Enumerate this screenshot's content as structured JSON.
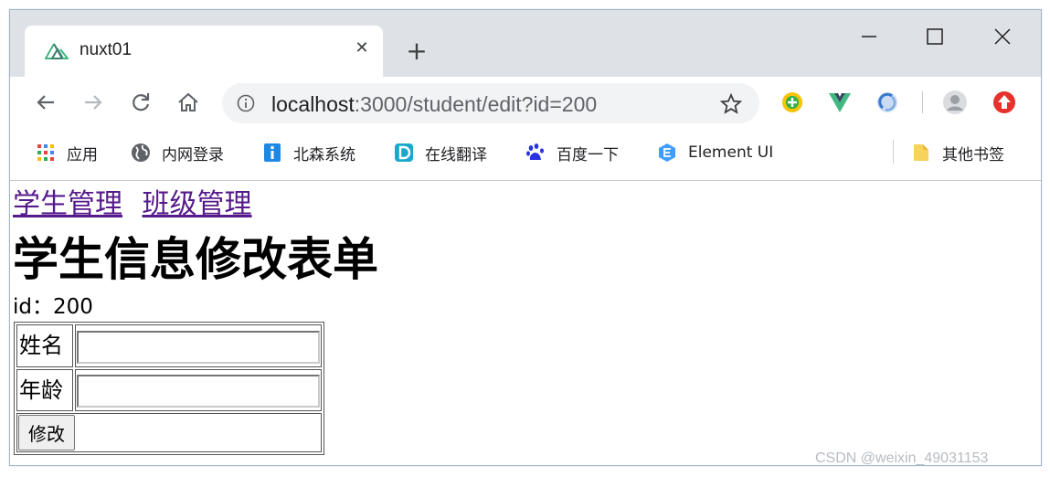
{
  "tab": {
    "title": "nuxt01",
    "close_glyph": "✕"
  },
  "new_tab_glyph": "+",
  "window_controls": [
    "minimize-icon",
    "maximize-icon",
    "close-icon"
  ],
  "toolbar": {
    "url_host": "localhost",
    "url_rest": ":3000/student/edit?id=200"
  },
  "bookmarks": [
    {
      "label": "应用",
      "icon": "apps-grid-icon"
    },
    {
      "label": "内网登录",
      "icon": "globe-icon"
    },
    {
      "label": "北森系统",
      "icon": "info-square-icon"
    },
    {
      "label": "在线翻译",
      "icon": "translate-d-icon"
    },
    {
      "label": "百度一下",
      "icon": "baidu-paw-icon"
    },
    {
      "label": "Element UI",
      "icon": "element-ui-icon"
    }
  ],
  "other_bookmarks": "其他书签",
  "page": {
    "nav_links": [
      "学生管理",
      "班级管理"
    ],
    "title": "学生信息修改表单",
    "id_label": "id：",
    "id_value": "200",
    "form": {
      "name_label": "姓名",
      "name_value": "",
      "age_label": "年龄",
      "age_value": "",
      "submit_label": "修改"
    }
  },
  "colors": {
    "tabstrip_bg": "#dee1e6",
    "omnibox_bg": "#f1f3f4",
    "visited_link": "#551a8b"
  },
  "watermark": "CSDN @weixin_49031153"
}
